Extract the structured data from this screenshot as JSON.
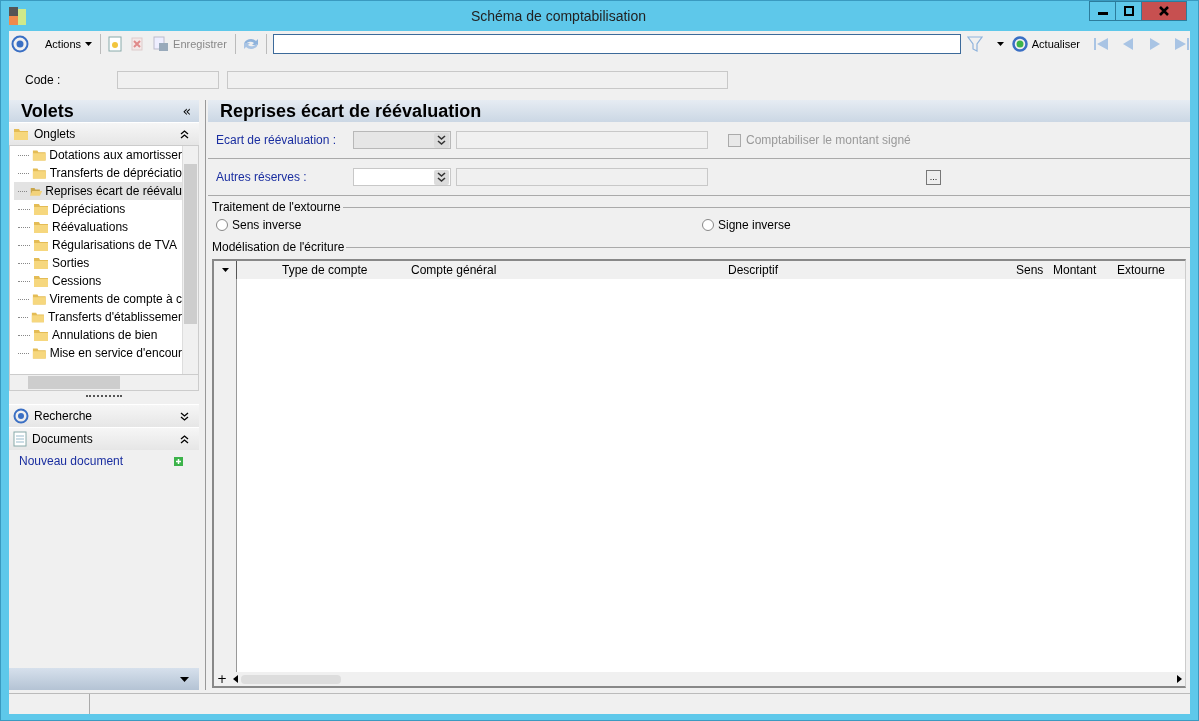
{
  "window": {
    "title": "Schéma de comptabilisation"
  },
  "toolbar": {
    "actions": "Actions",
    "save": "Enregistrer",
    "refresh": "Actualiser"
  },
  "code": {
    "label": "Code :"
  },
  "sidebar": {
    "title": "Volets",
    "collapse": "«",
    "sections": [
      {
        "kind": "tree",
        "label": "Onglets",
        "expanded": true,
        "items": [
          {
            "label": "Dotations aux amortisser",
            "selected": false
          },
          {
            "label": "Transferts de dépréciatio",
            "selected": false
          },
          {
            "label": "Reprises écart de réévalu",
            "selected": true
          },
          {
            "label": "Dépréciations",
            "selected": false
          },
          {
            "label": "Réévaluations",
            "selected": false
          },
          {
            "label": "Régularisations de TVA",
            "selected": false
          },
          {
            "label": "Sorties",
            "selected": false
          },
          {
            "label": "Cessions",
            "selected": false
          },
          {
            "label": "Virements de compte à c",
            "selected": false
          },
          {
            "label": "Transferts d'établissemer",
            "selected": false
          },
          {
            "label": "Annulations de bien",
            "selected": false
          },
          {
            "label": "Mise en service d'encour",
            "selected": false
          }
        ]
      },
      {
        "kind": "search",
        "label": "Recherche",
        "expanded": false
      },
      {
        "kind": "documents",
        "label": "Documents",
        "expanded": true,
        "link": "Nouveau document"
      }
    ]
  },
  "content": {
    "title": "Reprises écart de réévaluation",
    "fields": [
      {
        "label": "Ecart de réévaluation :",
        "disabled": true
      },
      {
        "label": "Autres réserves :",
        "disabled": false
      }
    ],
    "browse": "...",
    "checkbox": {
      "label": "Comptabiliser le montant signé",
      "checked": false,
      "disabled": true
    },
    "reversal": {
      "title": "Traitement de l'extourne",
      "radios": [
        {
          "label": "Sens inverse",
          "selected": false
        },
        {
          "label": "Signe inverse",
          "selected": false
        }
      ]
    },
    "entry": {
      "title": "Modélisation de l'écriture",
      "columns": [
        "Type de compte",
        "Compte général",
        "Descriptif",
        "Sens",
        "Montant",
        "Extourne"
      ],
      "add": "+"
    }
  }
}
